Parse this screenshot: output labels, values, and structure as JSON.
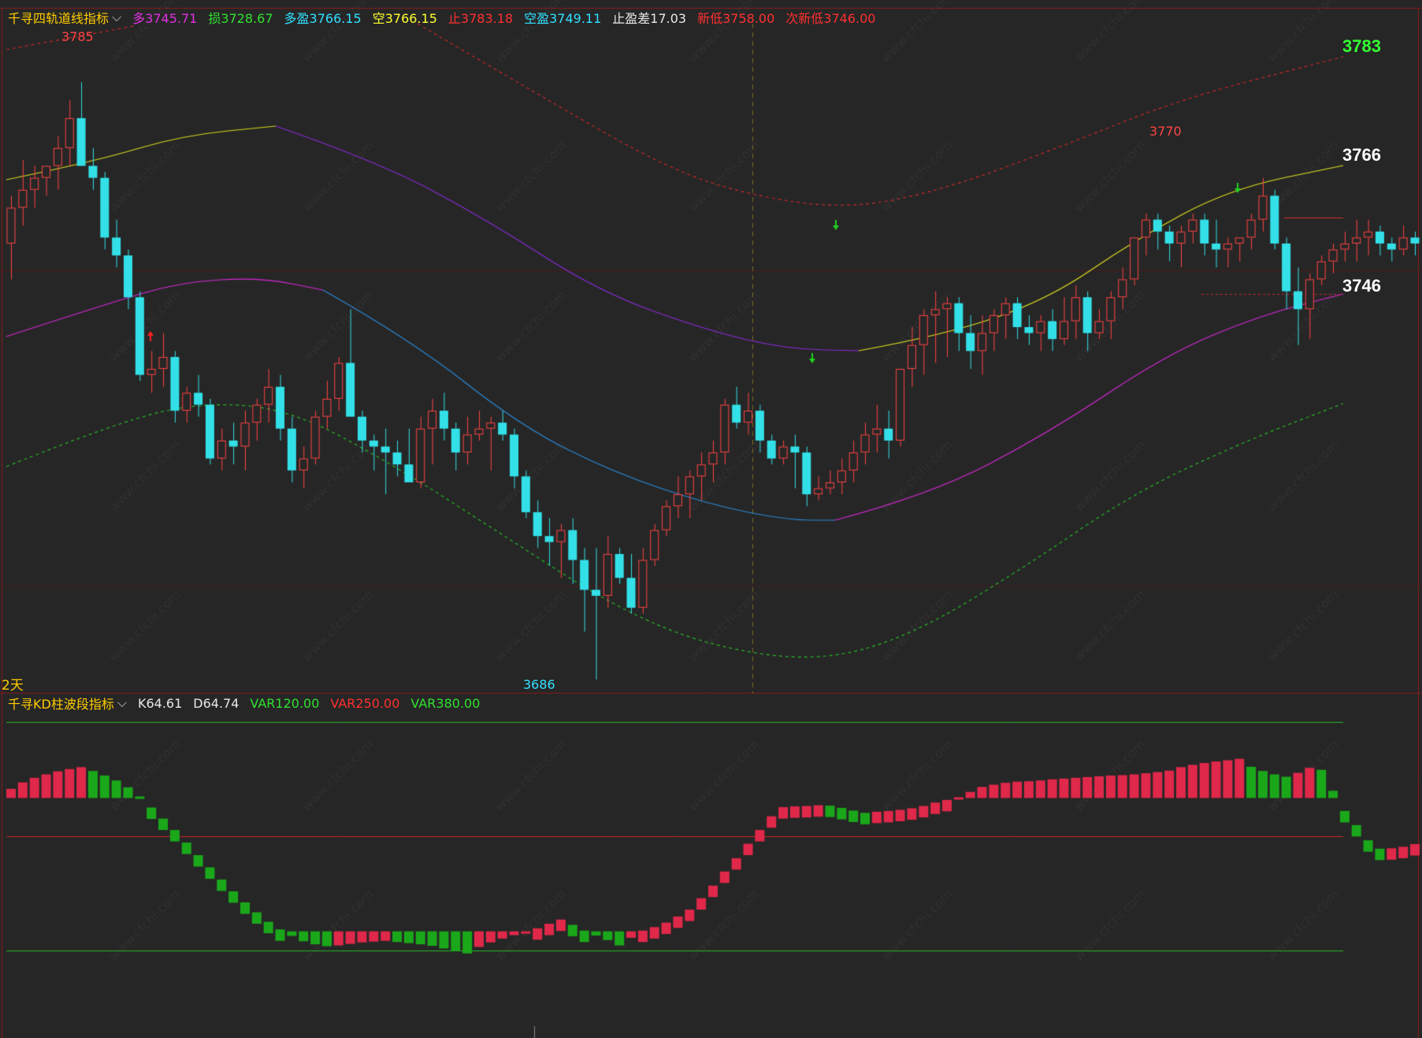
{
  "main_panel": {
    "indicator_name": "千寻四轨道线指标",
    "values": [
      {
        "label": "多",
        "value": "3745.71",
        "color": "#e030e0"
      },
      {
        "label": "损",
        "value": "3728.67",
        "color": "#30e030"
      },
      {
        "label": "多盈",
        "value": "3766.15",
        "color": "#30e0ff"
      },
      {
        "label": "空",
        "value": "3766.15",
        "color": "#ffff30"
      },
      {
        "label": "止",
        "value": "3783.18",
        "color": "#ff3030"
      },
      {
        "label": "空盈",
        "value": "3749.11",
        "color": "#30e0ff"
      },
      {
        "label": "止盈差",
        "value": "17.03",
        "color": "#e8e8e8"
      },
      {
        "label": "新低",
        "value": "3758.00",
        "color": "#ff3030"
      },
      {
        "label": "次新低",
        "value": "3746.00",
        "color": "#ff3030"
      }
    ],
    "right_labels": [
      {
        "text": "3783",
        "color": "#33ff33"
      },
      {
        "text": "3766",
        "color": "#ffffff"
      },
      {
        "text": "3746",
        "color": "#ffffff"
      }
    ],
    "peak_labels": [
      {
        "text": "3785",
        "color": "#ff4444"
      },
      {
        "text": "3770",
        "color": "#ff4444"
      },
      {
        "text": "3686",
        "color": "#33e0ff"
      }
    ],
    "period_label": "2天"
  },
  "sub_panel": {
    "indicator_name": "千寻KD柱波段指标",
    "values": [
      {
        "label": "K",
        "value": "64.61",
        "color": "#e8e8e8"
      },
      {
        "label": "D",
        "value": "64.74",
        "color": "#e8e8e8"
      },
      {
        "label": "VAR1",
        "value": "20.00",
        "color": "#30e030"
      },
      {
        "label": "VAR2",
        "value": "50.00",
        "color": "#ff3030"
      },
      {
        "label": "VAR3",
        "value": "80.00",
        "color": "#30e030"
      }
    ]
  },
  "colors": {
    "up": "#ff4444",
    "down": "#33e0e8",
    "background": "#262626",
    "kd_up": "#e0284a",
    "kd_down": "#1aa81a"
  },
  "chart_data": {
    "type": "candlestick",
    "price_range": [
      3686,
      3785
    ],
    "candles": [
      [
        3759,
        3767,
        3753,
        3765
      ],
      [
        3765,
        3773,
        3762,
        3768
      ],
      [
        3768,
        3772,
        3765,
        3770
      ],
      [
        3770,
        3772,
        3767,
        3772
      ],
      [
        3772,
        3777,
        3768,
        3775
      ],
      [
        3775,
        3783,
        3772,
        3780
      ],
      [
        3780,
        3786,
        3774,
        3772
      ],
      [
        3772,
        3775,
        3768,
        3770
      ],
      [
        3770,
        3771,
        3758,
        3760
      ],
      [
        3760,
        3763,
        3755,
        3757
      ],
      [
        3757,
        3758,
        3748,
        3750
      ],
      [
        3750,
        3751,
        3736,
        3737
      ],
      [
        3737,
        3741,
        3734,
        3738
      ],
      [
        3738,
        3744,
        3735,
        3740
      ],
      [
        3740,
        3741,
        3729,
        3731
      ],
      [
        3731,
        3735,
        3729,
        3734
      ],
      [
        3734,
        3737,
        3730,
        3732
      ],
      [
        3732,
        3733,
        3722,
        3723
      ],
      [
        3723,
        3728,
        3721,
        3726
      ],
      [
        3726,
        3729,
        3722,
        3725
      ],
      [
        3725,
        3731,
        3721,
        3729
      ],
      [
        3729,
        3733,
        3726,
        3732
      ],
      [
        3732,
        3738,
        3729,
        3735
      ],
      [
        3735,
        3737,
        3726,
        3728
      ],
      [
        3728,
        3730,
        3719,
        3721
      ],
      [
        3721,
        3725,
        3718,
        3723
      ],
      [
        3723,
        3731,
        3722,
        3730
      ],
      [
        3730,
        3736,
        3728,
        3733
      ],
      [
        3733,
        3740,
        3731,
        3739
      ],
      [
        3739,
        3748,
        3735,
        3730
      ],
      [
        3730,
        3731,
        3724,
        3726
      ],
      [
        3726,
        3727,
        3721,
        3725
      ],
      [
        3725,
        3728,
        3717,
        3724
      ],
      [
        3724,
        3726,
        3720,
        3722
      ],
      [
        3722,
        3728,
        3719,
        3719
      ],
      [
        3719,
        3730,
        3718,
        3728
      ],
      [
        3728,
        3733,
        3722,
        3731
      ],
      [
        3731,
        3734,
        3726,
        3728
      ],
      [
        3728,
        3729,
        3721,
        3724
      ],
      [
        3724,
        3730,
        3722,
        3727
      ],
      [
        3727,
        3731,
        3726,
        3728
      ],
      [
        3728,
        3730,
        3721,
        3729
      ],
      [
        3729,
        3731,
        3726,
        3727
      ],
      [
        3727,
        3728,
        3718,
        3720
      ],
      [
        3720,
        3721,
        3713,
        3714
      ],
      [
        3714,
        3716,
        3708,
        3710
      ],
      [
        3710,
        3713,
        3705,
        3709
      ],
      [
        3709,
        3712,
        3703,
        3711
      ],
      [
        3711,
        3713,
        3702,
        3706
      ],
      [
        3706,
        3708,
        3694,
        3701
      ],
      [
        3701,
        3708,
        3686,
        3700
      ],
      [
        3700,
        3710,
        3698,
        3707
      ],
      [
        3707,
        3708,
        3702,
        3703
      ],
      [
        3703,
        3707,
        3697,
        3698
      ],
      [
        3698,
        3708,
        3697,
        3706
      ],
      [
        3706,
        3712,
        3705,
        3711
      ],
      [
        3711,
        3716,
        3710,
        3715
      ],
      [
        3715,
        3720,
        3713,
        3717
      ],
      [
        3717,
        3721,
        3713,
        3720
      ],
      [
        3720,
        3724,
        3716,
        3722
      ],
      [
        3722,
        3726,
        3719,
        3724
      ],
      [
        3724,
        3733,
        3722,
        3732
      ],
      [
        3732,
        3735,
        3728,
        3729
      ],
      [
        3729,
        3734,
        3727,
        3731
      ],
      [
        3731,
        3732,
        3724,
        3726
      ],
      [
        3726,
        3727,
        3722,
        3723
      ],
      [
        3723,
        3726,
        3722,
        3725
      ],
      [
        3725,
        3727,
        3718,
        3724
      ],
      [
        3724,
        3725,
        3715,
        3717
      ],
      [
        3717,
        3720,
        3716,
        3718
      ],
      [
        3718,
        3721,
        3717,
        3719
      ],
      [
        3719,
        3723,
        3717,
        3721
      ],
      [
        3721,
        3726,
        3719,
        3724
      ],
      [
        3724,
        3729,
        3722,
        3727
      ],
      [
        3727,
        3732,
        3724,
        3728
      ],
      [
        3728,
        3731,
        3723,
        3726
      ],
      [
        3726,
        3738,
        3725,
        3738
      ],
      [
        3738,
        3745,
        3735,
        3742
      ],
      [
        3742,
        3748,
        3737,
        3747
      ],
      [
        3747,
        3751,
        3739,
        3748
      ],
      [
        3748,
        3750,
        3740,
        3749
      ],
      [
        3749,
        3750,
        3741,
        3744
      ],
      [
        3744,
        3747,
        3738,
        3741
      ],
      [
        3741,
        3747,
        3737,
        3744
      ],
      [
        3744,
        3748,
        3741,
        3747
      ],
      [
        3747,
        3750,
        3743,
        3749
      ],
      [
        3749,
        3750,
        3743,
        3745
      ],
      [
        3745,
        3747,
        3742,
        3744
      ],
      [
        3744,
        3747,
        3741,
        3746
      ],
      [
        3746,
        3748,
        3741,
        3743
      ],
      [
        3743,
        3750,
        3742,
        3746
      ],
      [
        3746,
        3752,
        3743,
        3750
      ],
      [
        3750,
        3751,
        3741,
        3744
      ],
      [
        3744,
        3748,
        3743,
        3746
      ],
      [
        3746,
        3751,
        3743,
        3750
      ],
      [
        3750,
        3755,
        3748,
        3753
      ],
      [
        3753,
        3760,
        3752,
        3760
      ],
      [
        3760,
        3764,
        3757,
        3763
      ],
      [
        3763,
        3764,
        3758,
        3761
      ],
      [
        3761,
        3762,
        3756,
        3759
      ],
      [
        3759,
        3762,
        3755,
        3761
      ],
      [
        3761,
        3764,
        3759,
        3763
      ],
      [
        3763,
        3764,
        3757,
        3759
      ],
      [
        3759,
        3763,
        3755,
        3758
      ],
      [
        3758,
        3760,
        3755,
        3759
      ],
      [
        3759,
        3760,
        3756,
        3760
      ],
      [
        3760,
        3764,
        3758,
        3763
      ],
      [
        3763,
        3770,
        3761,
        3767
      ],
      [
        3767,
        3768,
        3758,
        3759
      ],
      [
        3759,
        3760,
        3748,
        3751
      ],
      [
        3751,
        3755,
        3742,
        3748
      ],
      [
        3748,
        3754,
        3743,
        3753
      ],
      [
        3753,
        3757,
        3752,
        3756
      ],
      [
        3756,
        3759,
        3754,
        3758
      ],
      [
        3758,
        3761,
        3756,
        3759
      ],
      [
        3759,
        3763,
        3756,
        3760
      ],
      [
        3760,
        3763,
        3757,
        3761
      ],
      [
        3761,
        3762,
        3757,
        3759
      ],
      [
        3759,
        3760,
        3756,
        3758
      ],
      [
        3758,
        3762,
        3757,
        3760
      ],
      [
        3760,
        3761,
        3757,
        3759
      ],
      [
        3759,
        3762,
        3757,
        3760
      ],
      [
        3760,
        3761,
        3755,
        3758
      ]
    ],
    "kd_bars": [
      62.4,
      64.1,
      65.3,
      66.2,
      67.0,
      67.6,
      68.1,
      67.1,
      65.9,
      64.6,
      62.8,
      60.4,
      57.5,
      54.6,
      51.6,
      48.3,
      45.0,
      41.8,
      38.6,
      35.5,
      32.6,
      30.0,
      27.5,
      25.5,
      23.8,
      22.4,
      21.6,
      21.1,
      21.3,
      21.7,
      22.1,
      22.3,
      22.5,
      22.2,
      21.9,
      21.6,
      21.2,
      20.5,
      19.8,
      19.2,
      20.9,
      22.1,
      23.1,
      24.0,
      24.9,
      25.8,
      27.0,
      28.1,
      26.7,
      25.2,
      23.9,
      22.7,
      21.3,
      23.3,
      25.2,
      26.1,
      27.3,
      28.9,
      30.7,
      33.7,
      37.0,
      40.7,
      44.2,
      48.0,
      51.6,
      55.2,
      57.6,
      57.8,
      57.9,
      58.1,
      58.0,
      57.4,
      56.7,
      56.1,
      56.4,
      56.6,
      56.9,
      57.3,
      57.9,
      58.8,
      59.5,
      60.2,
      61.6,
      62.9,
      63.5,
      64.0,
      64.3,
      64.4,
      64.6,
      64.9,
      65.1,
      65.3,
      65.5,
      65.7,
      65.9,
      66.0,
      66.2,
      66.5,
      66.8,
      67.2,
      68.1,
      68.7,
      69.2,
      69.6,
      69.9,
      70.3,
      68.2,
      67.1,
      66.2,
      65.6,
      66.6,
      67.9,
      67.4,
      61.9,
      56.6,
      52.9,
      48.9,
      46.7,
      46.8,
      47.2,
      47.9,
      48.7,
      48.9,
      49.5,
      49.9,
      50.3,
      52.1,
      51.0
    ],
    "kd_range": [
      15,
      75
    ],
    "levels": [
      20,
      50,
      80
    ]
  }
}
